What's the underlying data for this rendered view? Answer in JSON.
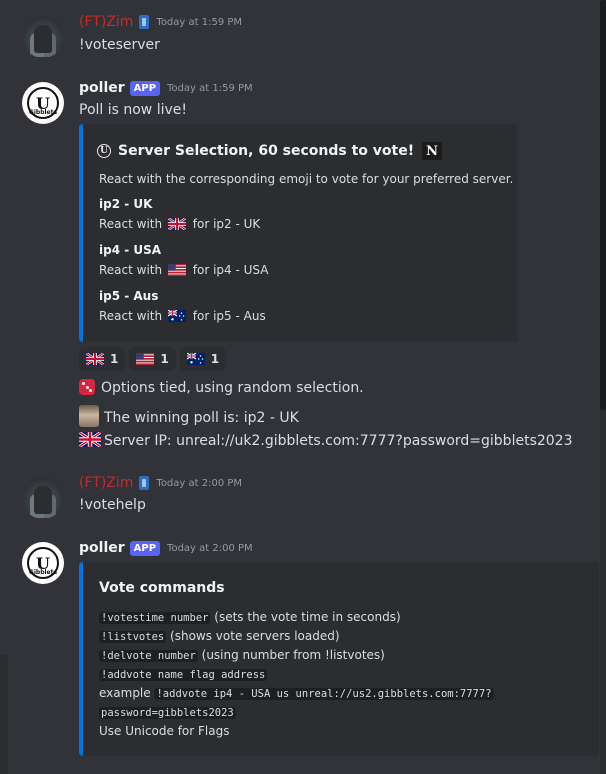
{
  "messages": {
    "m1": {
      "username": "(FT)Zim",
      "timestamp": "Today at 1:59 PM",
      "text": "!voteserver"
    },
    "m2": {
      "username": "poller",
      "app_tag": "APP",
      "timestamp": "Today at 1:59 PM",
      "text": "Poll is now live!",
      "embed": {
        "title": "Server Selection, 60 seconds to vote!",
        "description": "React with the corresponding emoji to vote for your preferred server.",
        "fields": [
          {
            "name": "ip2 - UK",
            "pre": "React with",
            "post": "for ip2 - UK"
          },
          {
            "name": "ip4 - USA",
            "pre": "React with",
            "post": "for ip4 - USA"
          },
          {
            "name": "ip5 - Aus",
            "pre": "React with",
            "post": "for ip5 - Aus"
          }
        ]
      },
      "reactions": [
        {
          "flag": "uk-flag-icon",
          "count": "1"
        },
        {
          "flag": "us-flag-icon",
          "count": "1"
        },
        {
          "flag": "au-flag-icon",
          "count": "1"
        }
      ],
      "followups": {
        "tied": "Options tied, using random selection.",
        "winner": "The winning poll is: ip2 - UK",
        "server_ip": "Server IP: unreal://uk2.gibblets.com:7777?password=gibblets2023"
      }
    },
    "m3": {
      "username": "(FT)Zim",
      "timestamp": "Today at 2:00 PM",
      "text": "!votehelp"
    },
    "m4": {
      "username": "poller",
      "app_tag": "APP",
      "timestamp": "Today at 2:00 PM",
      "embed": {
        "title": "Vote commands",
        "lines": [
          {
            "code": "!votestime number",
            "text": " (sets the vote time in seconds)"
          },
          {
            "code": "!listvotes",
            "text": " (shows vote servers loaded)"
          },
          {
            "code": "!delvote number",
            "text": " (using number from !listvotes)"
          },
          {
            "code": "!addvote name flag address",
            "text": ""
          }
        ],
        "example_prefix": "example",
        "example_code_1": "!addvote ip4 - USA us unreal://us2.gibblets.com:7777?",
        "example_code_2": "password=gibblets2023",
        "last": "Use Unicode for Flags"
      }
    }
  },
  "avatars": {
    "bot_initial": "U",
    "bot_text": "Gibblets"
  },
  "logo": {
    "n_letter": "N"
  },
  "colors": {
    "zim_name": "#c62a2a",
    "embed_bar": "#0077e0",
    "app_badge": "#5865f2",
    "background": "#313338"
  }
}
